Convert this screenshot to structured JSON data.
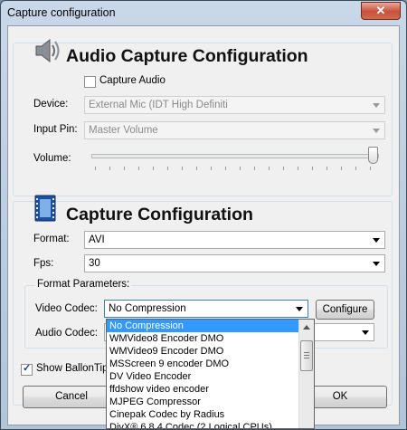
{
  "window": {
    "title": "Capture configuration",
    "close_glyph": "✕"
  },
  "audio": {
    "heading": "Audio Capture Configuration",
    "icon": "speaker-icon",
    "capture_audio_label": "Capture Audio",
    "capture_audio_checked": false,
    "device_label": "Device:",
    "device_value": "External Mic (IDT High Definiti",
    "input_pin_label": "Input Pin:",
    "input_pin_value": "Master Volume",
    "volume_label": "Volume:",
    "volume_level": 1.0
  },
  "video": {
    "heading": "Capture Configuration",
    "icon": "film-icon",
    "format_label": "Format:",
    "format_value": "AVI",
    "fps_label": "Fps:",
    "fps_value": "30",
    "params_legend": "Format Parameters:",
    "video_codec_label": "Video Codec:",
    "video_codec_value": "No Compression",
    "configure_label": "Configure",
    "audio_codec_label": "Audio Codec:"
  },
  "codec_options": [
    "No Compression",
    "WMVideo8 Encoder DMO",
    "WMVideo9 Encoder DMO",
    "MSScreen 9 encoder DMO",
    "DV Video Encoder",
    "ffdshow video encoder",
    "MJPEG Compressor",
    "Cinepak Codec by Radius",
    "DivX® 6.8.4 Codec (2 Logical CPUs)"
  ],
  "footer": {
    "show_tip_label": "Show BallonTip",
    "show_tip_checked": true,
    "cancel_label": "Cancel",
    "ok_label": "OK"
  },
  "colors": {
    "selection": "#3399ff",
    "close_button": "#c9503c"
  }
}
